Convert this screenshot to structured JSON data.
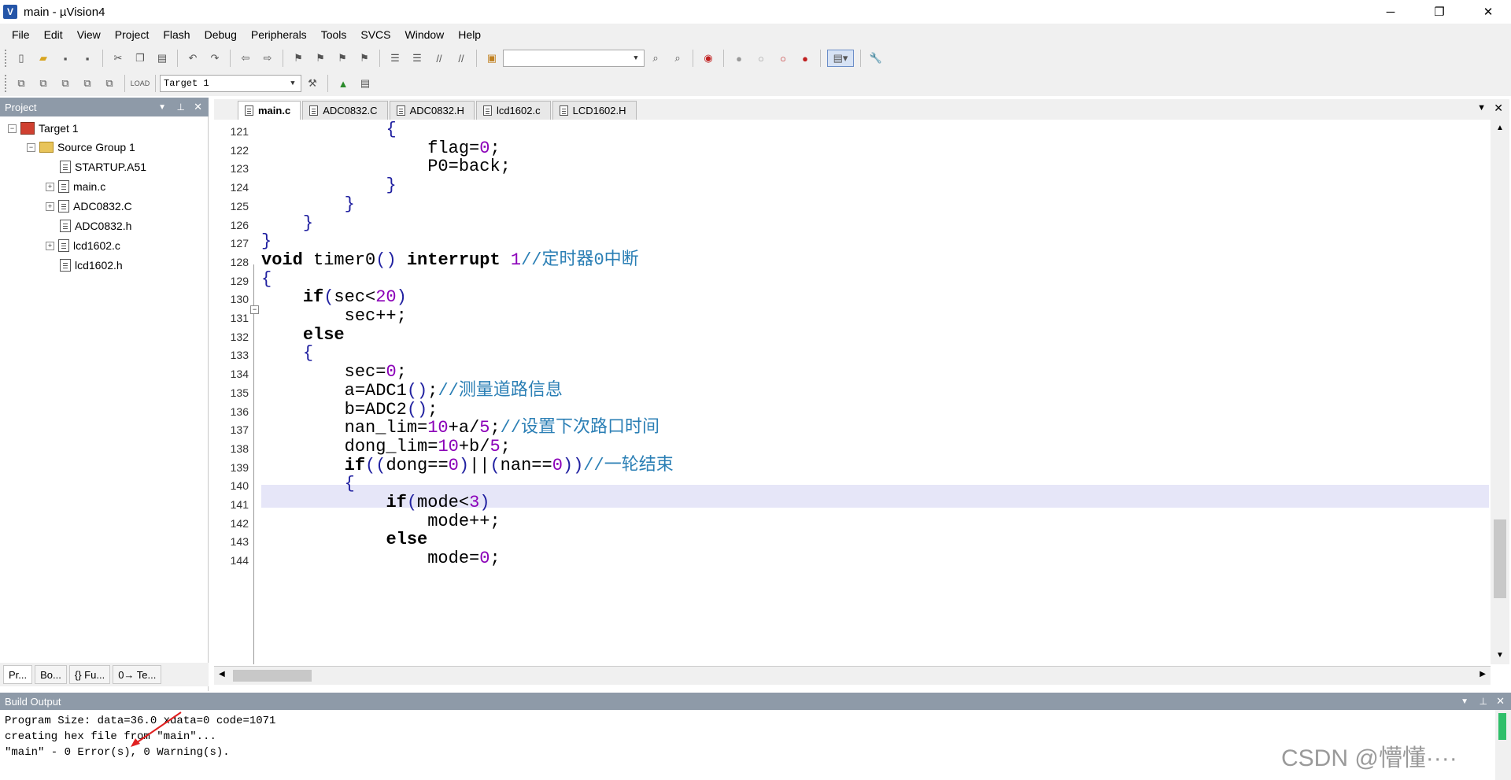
{
  "window": {
    "title": "main - µVision4",
    "app_icon_letter": "V",
    "minimize": "─",
    "restore": "❐",
    "close": "✕"
  },
  "menu": [
    "File",
    "Edit",
    "View",
    "Project",
    "Flash",
    "Debug",
    "Peripherals",
    "Tools",
    "SVCS",
    "Window",
    "Help"
  ],
  "toolbar2": {
    "target": "Target 1"
  },
  "project_panel": {
    "title": "Project",
    "tree": [
      {
        "label": "Target 1",
        "type": "target",
        "expander": "−"
      },
      {
        "label": "Source Group 1",
        "type": "folder",
        "expander": "−"
      },
      {
        "label": "STARTUP.A51",
        "type": "file",
        "expander": ""
      },
      {
        "label": "main.c",
        "type": "file",
        "expander": "+"
      },
      {
        "label": "ADC0832.C",
        "type": "file",
        "expander": "+"
      },
      {
        "label": "ADC0832.h",
        "type": "file",
        "expander": ""
      },
      {
        "label": "lcd1602.c",
        "type": "file",
        "expander": "+"
      },
      {
        "label": "lcd1602.h",
        "type": "file",
        "expander": ""
      }
    ],
    "tabs": [
      "Pr...",
      "Bo...",
      "{} Fu...",
      "0→ Te..."
    ]
  },
  "editor": {
    "tabs": [
      "main.c",
      "ADC0832.C",
      "ADC0832.H",
      "lcd1602.c",
      "LCD1602.H"
    ],
    "active_tab": "main.c",
    "lines": [
      {
        "n": "121",
        "code": "            {"
      },
      {
        "n": "122",
        "code": "                flag=0;"
      },
      {
        "n": "123",
        "code": "                P0=back;"
      },
      {
        "n": "124",
        "code": "            }"
      },
      {
        "n": "125",
        "code": "        }"
      },
      {
        "n": "126",
        "code": "    }"
      },
      {
        "n": "127",
        "code": "}"
      },
      {
        "n": "128",
        "code": "void timer0() interrupt 1//定时器0中断"
      },
      {
        "n": "129",
        "code": "{"
      },
      {
        "n": "130",
        "code": "    if(sec<20)"
      },
      {
        "n": "131",
        "code": "        sec++;"
      },
      {
        "n": "132",
        "code": "    else"
      },
      {
        "n": "133",
        "code": "    {"
      },
      {
        "n": "134",
        "code": "        sec=0;"
      },
      {
        "n": "135",
        "code": "        a=ADC1();//测量道路信息"
      },
      {
        "n": "136",
        "code": "        b=ADC2();"
      },
      {
        "n": "137",
        "code": "        nan_lim=10+a/5;//设置下次路口时间"
      },
      {
        "n": "138",
        "code": "        dong_lim=10+b/5;"
      },
      {
        "n": "139",
        "code": "        if((dong==0)||(nan==0))//一轮结束"
      },
      {
        "n": "140",
        "code": "        {"
      },
      {
        "n": "141",
        "code": "            if(mode<3)"
      },
      {
        "n": "142",
        "code": "                mode++;"
      },
      {
        "n": "143",
        "code": "            else"
      },
      {
        "n": "144",
        "code": "                mode=0;"
      }
    ]
  },
  "build_output": {
    "title": "Build Output",
    "lines": [
      "Program Size: data=36.0 xdata=0 code=1071",
      "creating hex file from \"main\"...",
      "\"main\" - 0 Error(s), 0 Warning(s)."
    ]
  },
  "watermark": "CSDN @懵懂····",
  "colors": {
    "panel_header": "#8e9aa8",
    "keyword": "#000000",
    "number": "#8b00b8",
    "comment": "#2b7fb5",
    "highlight_line": "#e6e6f8"
  }
}
